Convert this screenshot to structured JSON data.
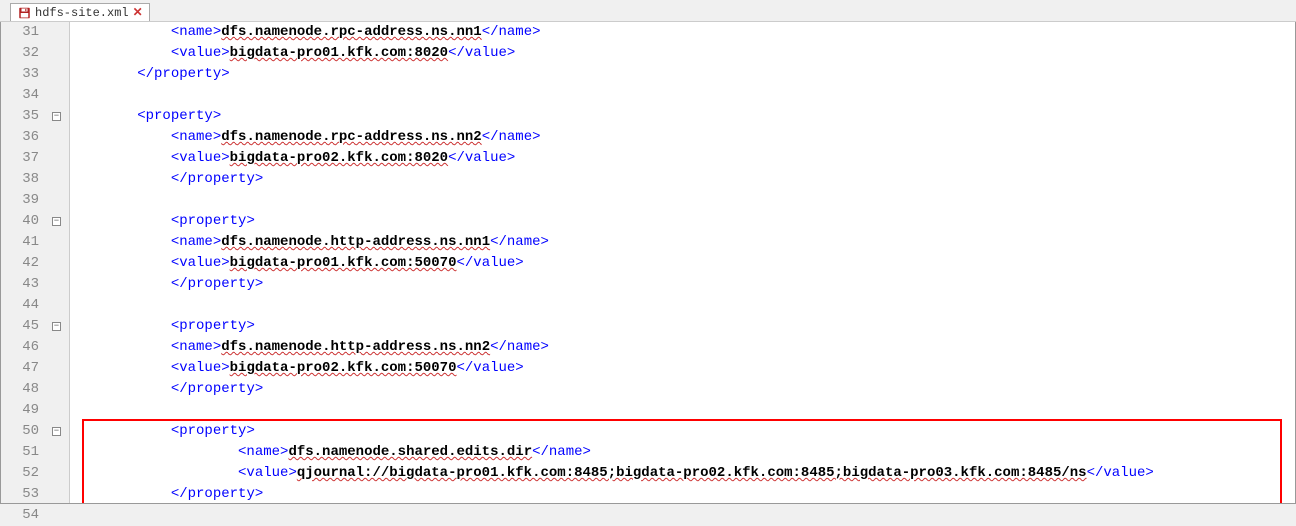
{
  "tab": {
    "filename": "hdfs-site.xml"
  },
  "lineStart": 31,
  "lines": [
    {
      "num": 31,
      "indent": "      ",
      "segments": [
        {
          "t": "tag",
          "v": "<name>"
        },
        {
          "t": "text",
          "v": "dfs.namenode.rpc-address.ns.nn1",
          "wavy": true
        },
        {
          "t": "tag",
          "v": "</name>"
        }
      ]
    },
    {
      "num": 32,
      "indent": "      ",
      "segments": [
        {
          "t": "tag",
          "v": "<value>"
        },
        {
          "t": "text",
          "v": "bigdata-pro01.kfk.com:8020",
          "wavy": true
        },
        {
          "t": "tag",
          "v": "</value>"
        }
      ]
    },
    {
      "num": 33,
      "indent": "    ",
      "segments": [
        {
          "t": "tag",
          "v": "</property>"
        }
      ]
    },
    {
      "num": 34,
      "indent": "",
      "segments": []
    },
    {
      "num": 35,
      "indent": "    ",
      "fold": true,
      "segments": [
        {
          "t": "tag",
          "v": "<property>"
        }
      ]
    },
    {
      "num": 36,
      "indent": "      ",
      "segments": [
        {
          "t": "tag",
          "v": "<name>"
        },
        {
          "t": "text",
          "v": "dfs.namenode.rpc-address.ns.nn2",
          "wavy": true
        },
        {
          "t": "tag",
          "v": "</name>"
        }
      ]
    },
    {
      "num": 37,
      "indent": "      ",
      "segments": [
        {
          "t": "tag",
          "v": "<value>"
        },
        {
          "t": "text",
          "v": "bigdata-pro02.kfk.com:8020",
          "wavy": true
        },
        {
          "t": "tag",
          "v": "</value>"
        }
      ]
    },
    {
      "num": 38,
      "indent": "      ",
      "segments": [
        {
          "t": "tag",
          "v": "</property>"
        }
      ]
    },
    {
      "num": 39,
      "indent": "",
      "segments": []
    },
    {
      "num": 40,
      "indent": "      ",
      "fold": true,
      "segments": [
        {
          "t": "tag",
          "v": "<property>"
        }
      ]
    },
    {
      "num": 41,
      "indent": "      ",
      "segments": [
        {
          "t": "tag",
          "v": "<name>"
        },
        {
          "t": "text",
          "v": "dfs.namenode.http-address.ns.nn1",
          "wavy": true
        },
        {
          "t": "tag",
          "v": "</name>"
        }
      ]
    },
    {
      "num": 42,
      "indent": "      ",
      "segments": [
        {
          "t": "tag",
          "v": "<value>"
        },
        {
          "t": "text",
          "v": "bigdata-pro01.kfk.com:50070",
          "wavy": true
        },
        {
          "t": "tag",
          "v": "</value>"
        }
      ]
    },
    {
      "num": 43,
      "indent": "      ",
      "segments": [
        {
          "t": "tag",
          "v": "</property>"
        }
      ]
    },
    {
      "num": 44,
      "indent": "",
      "segments": []
    },
    {
      "num": 45,
      "indent": "      ",
      "fold": true,
      "segments": [
        {
          "t": "tag",
          "v": "<property>"
        }
      ]
    },
    {
      "num": 46,
      "indent": "      ",
      "segments": [
        {
          "t": "tag",
          "v": "<name>"
        },
        {
          "t": "text",
          "v": "dfs.namenode.http-address.ns.nn2",
          "wavy": true
        },
        {
          "t": "tag",
          "v": "</name>"
        }
      ]
    },
    {
      "num": 47,
      "indent": "      ",
      "segments": [
        {
          "t": "tag",
          "v": "<value>"
        },
        {
          "t": "text",
          "v": "bigdata-pro02.kfk.com:50070",
          "wavy": true
        },
        {
          "t": "tag",
          "v": "</value>"
        }
      ]
    },
    {
      "num": 48,
      "indent": "      ",
      "segments": [
        {
          "t": "tag",
          "v": "</property>"
        }
      ]
    },
    {
      "num": 49,
      "indent": "",
      "segments": []
    },
    {
      "num": 50,
      "indent": "      ",
      "fold": true,
      "segments": [
        {
          "t": "tag",
          "v": "<property>"
        }
      ]
    },
    {
      "num": 51,
      "indent": "          ",
      "segments": [
        {
          "t": "tag",
          "v": "<name>"
        },
        {
          "t": "text",
          "v": "dfs.namenode.shared.edits.dir",
          "wavy": true
        },
        {
          "t": "tag",
          "v": "</name>"
        }
      ]
    },
    {
      "num": 52,
      "indent": "          ",
      "segments": [
        {
          "t": "tag",
          "v": "<value>"
        },
        {
          "t": "text",
          "v": "qjournal://bigdata-pro01.kfk.com:8485;bigdata-pro02.kfk.com:8485;bigdata-pro03.kfk.com:8485/ns",
          "wavy": true
        },
        {
          "t": "tag",
          "v": "</value>"
        }
      ]
    },
    {
      "num": 53,
      "indent": "      ",
      "segments": [
        {
          "t": "tag",
          "v": "</property>"
        }
      ]
    },
    {
      "num": 54,
      "indent": "",
      "segments": []
    }
  ],
  "highlight": {
    "startLine": 50,
    "endLine": 53
  }
}
